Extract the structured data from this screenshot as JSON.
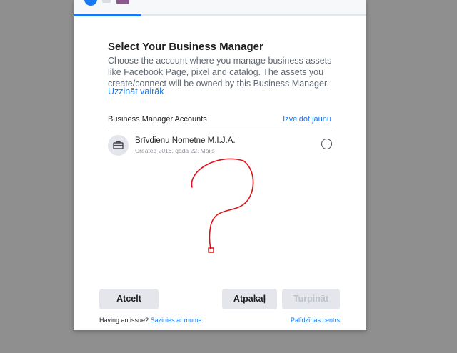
{
  "dialog": {
    "progress_fraction": 0.23,
    "title": "Select Your Business Manager",
    "description": "Choose the account where you manage business assets like Facebook Page, pixel and catalog. The assets you create/connect will be owned by this Business Manager.",
    "learn_more": "Uzzināt vairāk"
  },
  "accounts": {
    "header": "Business Manager Accounts",
    "create_new": "Izveidot jaunu",
    "items": [
      {
        "name": "Brīvdienu Nometne M.I.J.A.",
        "created": "Created 2018. gada 22. Maijs",
        "icon": "briefcase-icon",
        "selected": false
      }
    ]
  },
  "buttons": {
    "cancel": "Atcelt",
    "back": "Atpakaļ",
    "next": "Turpināt"
  },
  "footer": {
    "issue_text": "Having an issue?",
    "contact_link": "Sazinies ar mums",
    "help_center": "Palīdzības centrs"
  },
  "colors": {
    "accent": "#1877f2",
    "annotation": "#e0101a",
    "backdrop": "#8f8f8f"
  }
}
